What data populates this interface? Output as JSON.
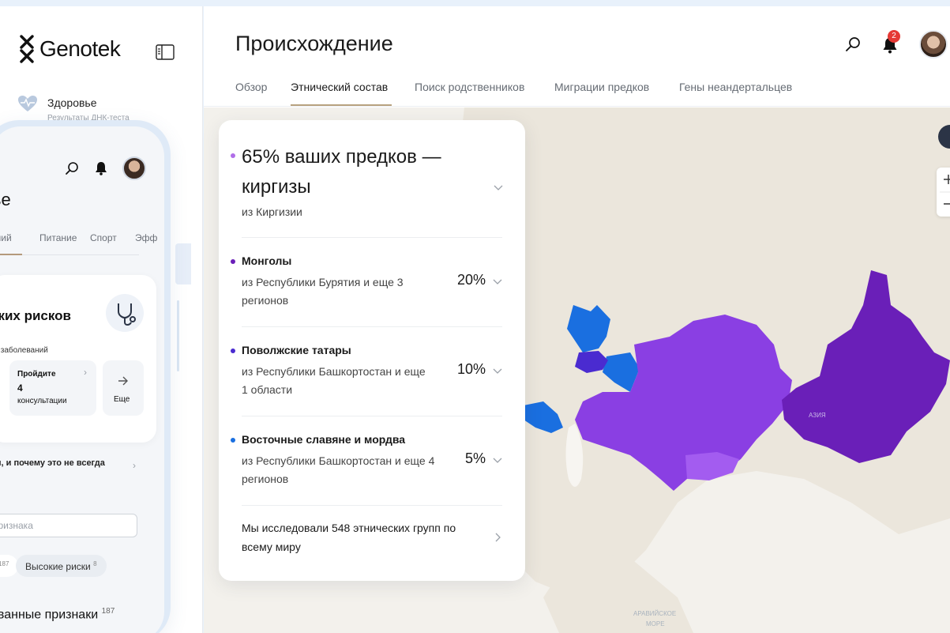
{
  "brand": {
    "name": "Genotek"
  },
  "sidebar": {
    "health": {
      "title": "Здоровье",
      "subtitle": "Результаты ДНК-теста"
    }
  },
  "phone": {
    "title": "ье",
    "tabs": [
      "аний",
      "Питание",
      "Спорт",
      "Эфф"
    ],
    "card": {
      "title": "ских рисков",
      "subtitle": "ки заболеваний",
      "mini": [
        {
          "label": "Пройдите",
          "value": "4",
          "sub": "консультации"
        },
        {
          "label": "Еще"
        }
      ]
    },
    "row_text": "ии, и почему это не всегда",
    "search_placeholder": "признака",
    "chips": [
      {
        "label": "и",
        "count": "187"
      },
      {
        "label": "Высокие риски",
        "count": "8"
      }
    ],
    "bottom_title": "ованные признаки",
    "bottom_count": "187"
  },
  "header": {
    "title": "Происхождение",
    "notification_count": "2"
  },
  "tabs": [
    {
      "label": "Обзор",
      "active": false
    },
    {
      "label": "Этнический состав",
      "active": true
    },
    {
      "label": "Поиск родственников",
      "active": false
    },
    {
      "label": "Миграции предков",
      "active": false
    },
    {
      "label": "Гены неандертальцев",
      "active": false
    }
  ],
  "map": {
    "labels": {
      "asia": "АЗИЯ",
      "sea_line1": "АРАВИЙСКОЕ",
      "sea_line2": "МОРЕ"
    },
    "colors": {
      "dark_purple": "#6a1fb8",
      "purple": "#8a3fe3",
      "light_purple": "#a35cf0",
      "blue": "#1a6fe0",
      "indigo": "#4a2bd0"
    }
  },
  "ancestry": {
    "main": {
      "title": "65% ваших предков — киргизы",
      "subtitle": "из Киргизии",
      "dot_color": "#b06ee8"
    },
    "items": [
      {
        "title": "Монголы",
        "subtitle": "из Республики Бурятия и еще 3 регионов",
        "percent": "20%",
        "dot_color": "#6a1fb8"
      },
      {
        "title": "Поволжские татары",
        "subtitle": "из Республики Башкортостан и еще 1 области",
        "percent": "10%",
        "dot_color": "#4a2bd0"
      },
      {
        "title": "Восточные славяне и мордва",
        "subtitle": "из Республики Башкортостан и еще 4 регионов",
        "percent": "5%",
        "dot_color": "#1a6fe0"
      }
    ],
    "footer": "Мы исследовали 548 этнических групп по всему миру"
  }
}
